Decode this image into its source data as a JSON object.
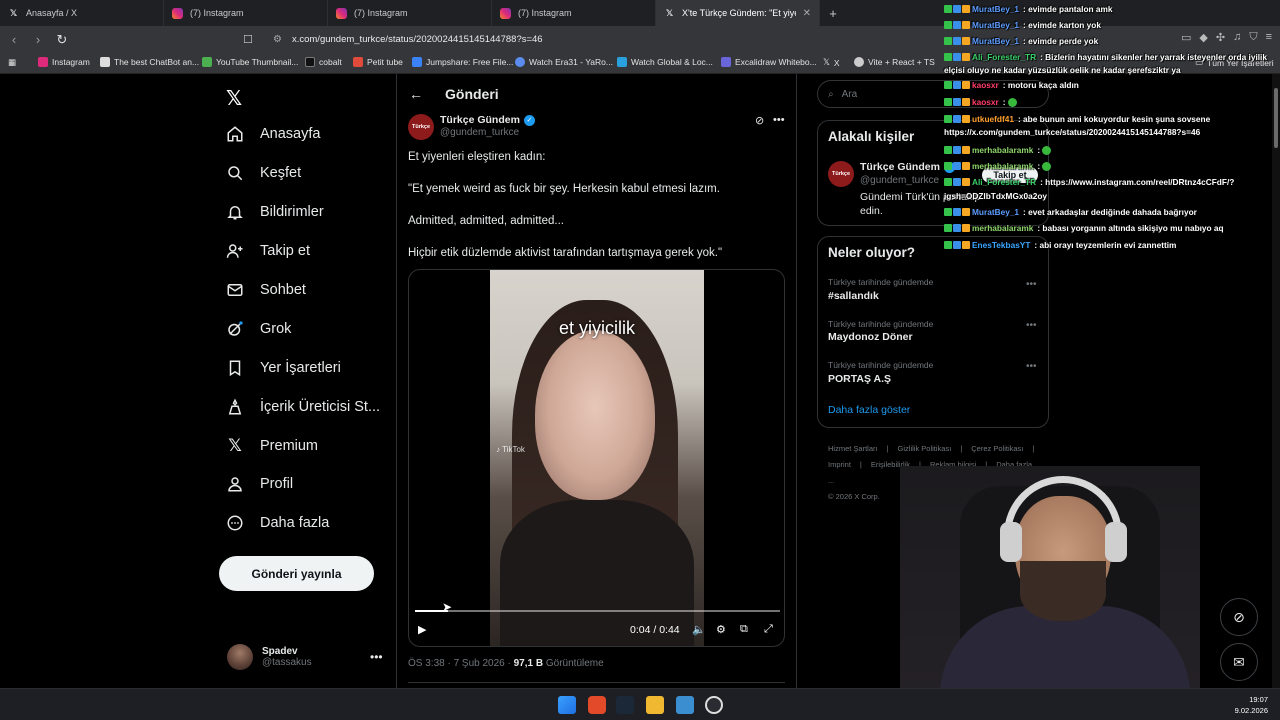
{
  "browser": {
    "tabs": [
      {
        "title": "Anasayfa / X",
        "icon": "x-icon",
        "active": false
      },
      {
        "title": "(7) Instagram",
        "icon": "instagram-icon",
        "active": false
      },
      {
        "title": "(7) Instagram",
        "icon": "instagram-icon",
        "active": false
      },
      {
        "title": "(7) Instagram",
        "icon": "instagram-icon",
        "active": false
      },
      {
        "title": "X'te Türkçe Gündem: \"Et yiyen",
        "icon": "x-icon",
        "active": true
      }
    ],
    "new_tab": "+",
    "url": "x.com/gundem_turkce/status/2020024415145144788?s=46",
    "bookmarks": [
      "Instagram",
      "The best ChatBot an...",
      "YouTube Thumbnail...",
      "cobalt",
      "Petit tube",
      "Jumpshare: Free File...",
      "Watch Era31 - YaRo...",
      "Watch Global & Loc...",
      "Excalidraw Whitebo...",
      "X",
      "Vite + React + TS",
      "Tüm Yer İşaretleri"
    ]
  },
  "sidebar": {
    "items": [
      {
        "label": "Anasayfa",
        "icon": "home-icon"
      },
      {
        "label": "Keşfet",
        "icon": "search-icon"
      },
      {
        "label": "Bildirimler",
        "icon": "bell-icon"
      },
      {
        "label": "Takip et",
        "icon": "person-add-icon"
      },
      {
        "label": "Sohbet",
        "icon": "mail-icon"
      },
      {
        "label": "Grok",
        "icon": "grok-icon"
      },
      {
        "label": "Yer İşaretleri",
        "icon": "bookmark-icon"
      },
      {
        "label": "İçerik Üreticisi St...",
        "icon": "creator-icon"
      },
      {
        "label": "Premium",
        "icon": "x-icon"
      },
      {
        "label": "Profil",
        "icon": "person-icon"
      },
      {
        "label": "Daha fazla",
        "icon": "more-circle-icon"
      }
    ],
    "post_button": "Gönderi yayınla",
    "account": {
      "name": "Spadev",
      "handle": "@tassakus"
    }
  },
  "post": {
    "page_title": "Gönderi",
    "author_name": "Türkçe Gündem",
    "author_handle": "@gundem_turkce",
    "avatar_text": "Türkçe",
    "lines": [
      "Et yiyenleri eleştiren kadın:",
      "\"Et yemek weird as fuck bir şey. Herkesin kabul etmesi lazım.",
      "Admitted, admitted, admitted...",
      "Hiçbir etik düzlemde aktivist tarafından tartışmaya gerek yok.\""
    ],
    "video": {
      "caption": "et yiyicilik",
      "watermark": "TikTok",
      "current_time": "0:04",
      "duration": "0:44",
      "time_display": "0:04 / 0:44",
      "progress": 0.09
    },
    "timestamp": "ÖS 3:38 · 7 Şub 2026 · ",
    "views": "97,1 B",
    "views_label": " Görüntüleme"
  },
  "right": {
    "search_placeholder": "Ara",
    "related": {
      "heading": "Alakalı kişiler",
      "name": "Türkçe Gündem",
      "handle": "@gundem_turkce",
      "bio": "Gündemi Türk'ün portakip edin.",
      "follow": "Takip et"
    },
    "trends": {
      "heading": "Neler oluyor?",
      "items": [
        {
          "context": "Türkiye tarihinde gündemde",
          "name": "#sallandık"
        },
        {
          "context": "Türkiye tarihinde gündemde",
          "name": "Maydonoz Döner"
        },
        {
          "context": "Türkiye tarihinde gündemde",
          "name": "PORTAŞ A.Ş"
        }
      ],
      "show_more": "Daha fazla göster"
    },
    "footer": [
      "Hizmet Şartları",
      "|",
      "Gizlilik Politikası",
      "|",
      "Çerez Politikası",
      "|",
      "Imprint",
      "|",
      "Erişilebilirlik",
      "|",
      "Reklam bilgisi",
      "|",
      "Daha fazla ...",
      "© 2026 X Corp."
    ]
  },
  "chat": [
    {
      "user": "MuratBey_1",
      "color": "#5b9cff",
      "text": ": evimde pantalon amk"
    },
    {
      "user": "MuratBey_1",
      "color": "#5b9cff",
      "text": ": evimde karton yok"
    },
    {
      "user": "MuratBey_1",
      "color": "#5b9cff",
      "text": ": evimde perde yok"
    },
    {
      "user": "Ali_Forester_TR",
      "color": "#3ad16a",
      "text": ": Bizlerin hayatını sikenler her yarrak isteyenler orda iyilik"
    },
    {
      "user": "",
      "color": "#fff",
      "text": "elçisi oluyo ne kadar yüzsüzlük oelik ne kadar şerefsziktr ya"
    },
    {
      "user": "kaosxr",
      "color": "#ff3d6a",
      "text": ": motoru kaça aldın"
    },
    {
      "user": "kaosxr",
      "color": "#ff3d6a",
      "text": ":"
    },
    {
      "user": "utkuefdf41",
      "color": "#ff9f2e",
      "text": ": abe bunun ami kokuyordur kesin şuna sovsene"
    },
    {
      "user": "",
      "color": "#fff",
      "text": "https://x.com/gundem_turkce/status/2020024415145144788?s=46"
    },
    {
      "user": "merhabalaramk",
      "color": "#8fd66b",
      "text": ":"
    },
    {
      "user": "merhabalaramk",
      "color": "#8fd66b",
      "text": ":"
    },
    {
      "user": "Ali_Forester_TR",
      "color": "#3ad16a",
      "text": ": https://www.instagram.com/reel/DRtnz4cCFdF/?"
    },
    {
      "user": "",
      "color": "#fff",
      "text": "igsh=ODZlbTdxMGx0a2oy"
    },
    {
      "user": "MuratBey_1",
      "color": "#5b9cff",
      "text": ": evet arkadaşlar dediğinde dahada bağrıyor"
    },
    {
      "user": "merhabalaramk",
      "color": "#8fd66b",
      "text": ": babası yorganın altında sikişiyo mu nabıyo aq"
    },
    {
      "user": "EnesTekbasYT",
      "color": "#3aa5ff",
      "text": ": abi orayı teyzemlerin evi zannettim"
    }
  ],
  "clock": {
    "time": "19:07",
    "date": "9.02.2026"
  },
  "colors": {
    "accent": "#1d9bf0",
    "background": "#000000",
    "border": "#2f3336",
    "muted": "#71767b"
  }
}
